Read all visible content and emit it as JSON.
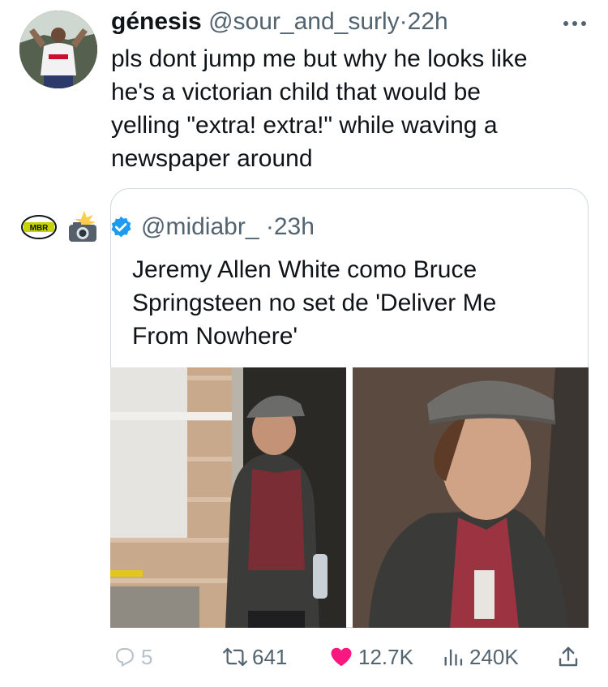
{
  "tweet": {
    "author_name": "génesis",
    "author_handle": "@sour_and_surly",
    "separator": "·",
    "time": "22h",
    "text": "pls dont jump me but why he looks like\nhe's a victorian child that would be\nyelling \"extra! extra!\" while waving a\nnewspaper around"
  },
  "quote": {
    "logo_text": "MBR",
    "handle": "@midiabr_",
    "separator": "·",
    "time": "23h",
    "text": "Jeremy Allen White como Bruce\nSpringsteen no set de 'Deliver Me\nFrom Nowhere'"
  },
  "actions": {
    "replies": "5",
    "retweets": "641",
    "likes": "12.7K",
    "views": "240K"
  },
  "colors": {
    "text_primary": "#0f1419",
    "text_secondary": "#536471",
    "like_pink": "#f91880",
    "verified_blue": "#1d9bf0",
    "border": "#cfd9de"
  },
  "icons": [
    "more-icon",
    "verified-icon",
    "camera-icon",
    "reply-icon",
    "retweet-icon",
    "heart-icon",
    "views-icon",
    "share-icon"
  ]
}
